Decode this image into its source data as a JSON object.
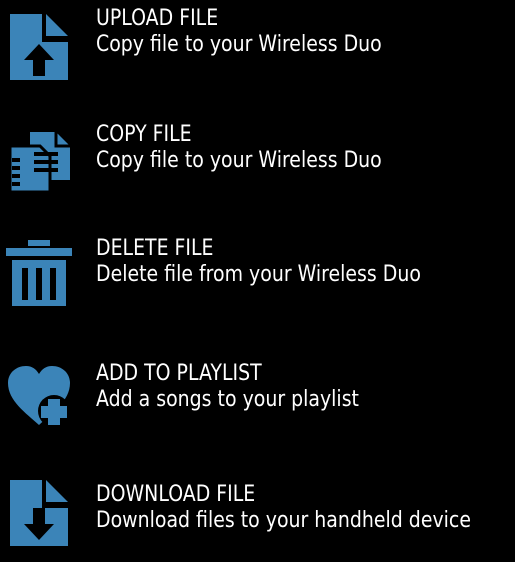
{
  "colors": {
    "background": "#000000",
    "icon": "#3b84b8",
    "text": "#ffffff"
  },
  "items": [
    {
      "icon": "upload-file-icon",
      "title": "UPLOAD FILE",
      "subtitle": "Copy file to your Wireless Duo"
    },
    {
      "icon": "copy-file-icon",
      "title": "COPY FILE",
      "subtitle": "Copy file to your Wireless Duo"
    },
    {
      "icon": "trash-icon",
      "title": "DELETE FILE",
      "subtitle": "Delete file from your Wireless Duo"
    },
    {
      "icon": "heart-plus-icon",
      "title": "ADD TO PLAYLIST",
      "subtitle": "Add a songs to your playlist"
    },
    {
      "icon": "download-file-icon",
      "title": "DOWNLOAD FILE",
      "subtitle": "Download files to your handheld device"
    }
  ]
}
